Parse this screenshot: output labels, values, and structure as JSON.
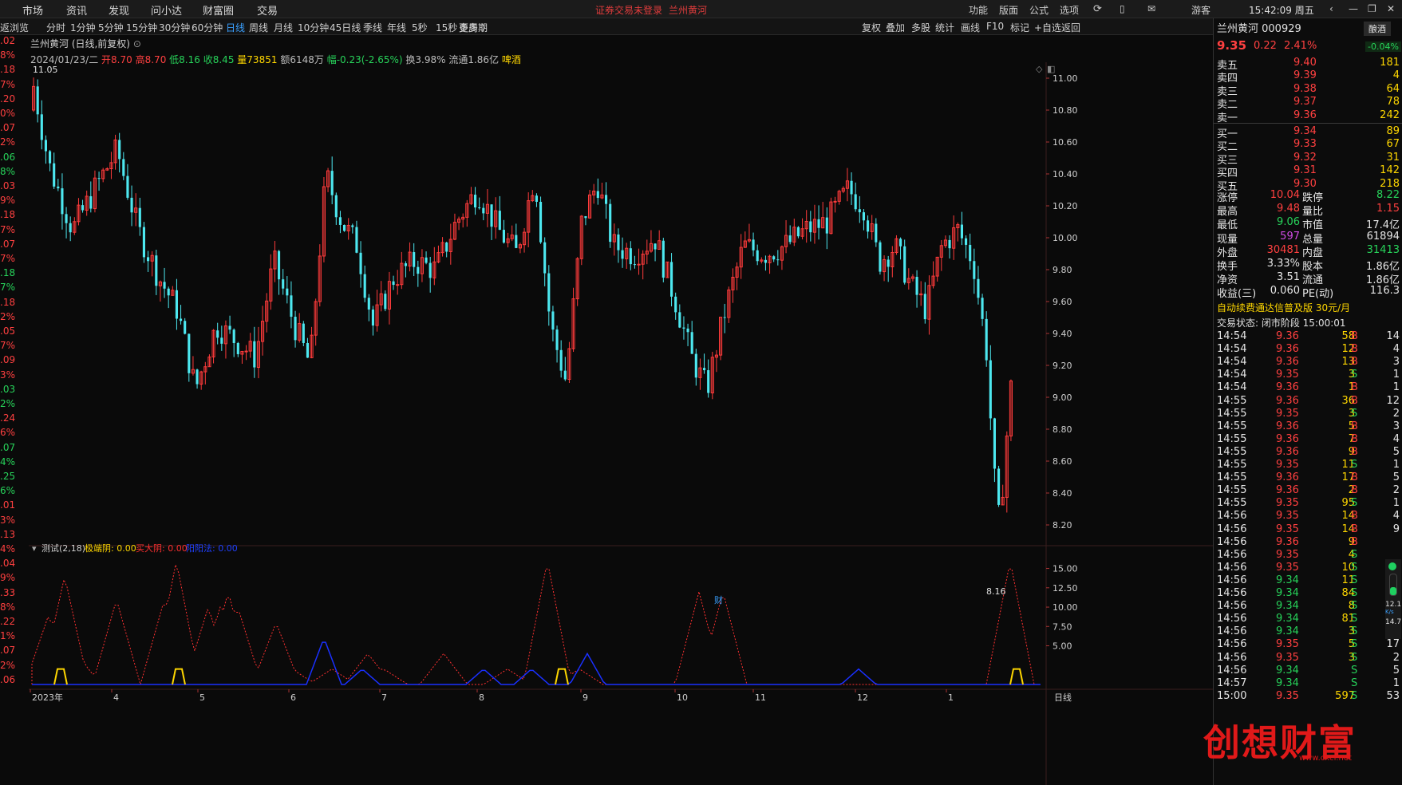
{
  "topbar": {
    "menus": [
      "市场",
      "资讯",
      "发现",
      "问小达",
      "财富圈",
      "交易"
    ],
    "notice_login": "证券交易未登录",
    "notice_stock": "兰州黄河",
    "tools": [
      "功能",
      "版面",
      "公式",
      "选项"
    ],
    "user": "游客",
    "clock": "15:42:09 周五"
  },
  "periodbar": {
    "left_label": "返浏览",
    "periods": [
      "分时",
      "1分钟",
      "5分钟",
      "15分钟",
      "30分钟",
      "60分钟",
      "日线",
      "周线",
      "月线",
      "10分钟",
      "45日线",
      "季线",
      "年线",
      "5秒",
      "15秒",
      "多周期",
      "更多 〉"
    ],
    "active": "日线",
    "right_tools": [
      "复权",
      "叠加",
      "多股",
      "统计",
      "画线",
      "F10",
      "标记",
      "+自选",
      "返回"
    ]
  },
  "chart": {
    "title": "兰州黄河 (日线,前复权)",
    "date": "2024/01/23/二",
    "open_label": "开8.70",
    "high_label": "高8.70",
    "low_label": "低8.16",
    "close_label": "收8.45",
    "volume_label": "量73851",
    "amount_label": "额6148万",
    "change_label": "幅-0.23(-2.65%)",
    "turnover_label": "换3.98%",
    "float_label": "流通1.86亿",
    "sector_label": "啤酒",
    "max_marker": "11.05",
    "min_marker": "8.16",
    "price_ticks": [
      "11.00",
      "10.80",
      "10.60",
      "10.40",
      "10.20",
      "10.00",
      "9.80",
      "9.60",
      "9.40",
      "9.20",
      "9.00",
      "8.80",
      "8.60",
      "8.40",
      "8.20"
    ],
    "finance_marker": "财",
    "indicator_label": "测试(2,18)",
    "ind_series1": "极端阴: 0.00",
    "ind_series2": "买大阴: 0.00",
    "ind_series3": "阳阳法: 0.00",
    "ind_ticks": [
      "15.00",
      "12.50",
      "10.00",
      "7.50",
      "5.00"
    ],
    "x_labels": [
      "2023年",
      "4",
      "5",
      "6",
      "7",
      "8",
      "9",
      "10",
      "11",
      "12",
      "1"
    ],
    "x_right_label": "日线"
  },
  "left_strip": [
    {
      "t": ".02",
      "c": "#ff4040"
    },
    {
      "t": "8%",
      "c": "#ff4040"
    },
    {
      "t": ".18",
      "c": "#ff4040"
    },
    {
      "t": "7%",
      "c": "#ff4040"
    },
    {
      "t": ".20",
      "c": "#ff4040"
    },
    {
      "t": "0%",
      "c": "#ff4040"
    },
    {
      "t": ".07",
      "c": "#ff4040"
    },
    {
      "t": "2%",
      "c": "#ff4040"
    },
    {
      "t": ".06",
      "c": "#27d35a"
    },
    {
      "t": "8%",
      "c": "#27d35a"
    },
    {
      "t": ".03",
      "c": "#ff4040"
    },
    {
      "t": "9%",
      "c": "#ff4040"
    },
    {
      "t": ".18",
      "c": "#ff4040"
    },
    {
      "t": "7%",
      "c": "#ff4040"
    },
    {
      "t": ".07",
      "c": "#ff4040"
    },
    {
      "t": "7%",
      "c": "#ff4040"
    },
    {
      "t": ".18",
      "c": "#27d35a"
    },
    {
      "t": "7%",
      "c": "#27d35a"
    },
    {
      "t": ".18",
      "c": "#ff4040"
    },
    {
      "t": "2%",
      "c": "#ff4040"
    },
    {
      "t": ".05",
      "c": "#ff4040"
    },
    {
      "t": "7%",
      "c": "#ff4040"
    },
    {
      "t": ".09",
      "c": "#ff4040"
    },
    {
      "t": "3%",
      "c": "#ff4040"
    },
    {
      "t": ".03",
      "c": "#27d35a"
    },
    {
      "t": "2%",
      "c": "#27d35a"
    },
    {
      "t": ".24",
      "c": "#ff4040"
    },
    {
      "t": "6%",
      "c": "#ff4040"
    },
    {
      "t": ".07",
      "c": "#27d35a"
    },
    {
      "t": "4%",
      "c": "#27d35a"
    },
    {
      "t": ".25",
      "c": "#27d35a"
    },
    {
      "t": "6%",
      "c": "#27d35a"
    },
    {
      "t": ".01",
      "c": "#ff4040"
    },
    {
      "t": "3%",
      "c": "#ff4040"
    },
    {
      "t": ".13",
      "c": "#ff4040"
    },
    {
      "t": "4%",
      "c": "#ff4040"
    },
    {
      "t": ".04",
      "c": "#ff4040"
    },
    {
      "t": "9%",
      "c": "#ff4040"
    },
    {
      "t": ".33",
      "c": "#ff4040"
    },
    {
      "t": "8%",
      "c": "#ff4040"
    },
    {
      "t": ".22",
      "c": "#ff4040"
    },
    {
      "t": "1%",
      "c": "#ff4040"
    },
    {
      "t": ".07",
      "c": "#ff4040"
    },
    {
      "t": "2%",
      "c": "#ff4040"
    },
    {
      "t": ".06",
      "c": "#ff4040"
    }
  ],
  "quote": {
    "name": "兰州黄河 000929",
    "sector": "酿酒",
    "price": "9.35",
    "change": "0.22",
    "pct": "2.41%",
    "sector_pct": "-0.04%",
    "asks": [
      {
        "label": "卖五",
        "price": "9.40",
        "vol": "181"
      },
      {
        "label": "卖四",
        "price": "9.39",
        "vol": "4"
      },
      {
        "label": "卖三",
        "price": "9.38",
        "vol": "64"
      },
      {
        "label": "卖二",
        "price": "9.37",
        "vol": "78"
      },
      {
        "label": "卖一",
        "price": "9.36",
        "vol": "242"
      }
    ],
    "bids": [
      {
        "label": "买一",
        "price": "9.34",
        "vol": "89"
      },
      {
        "label": "买二",
        "price": "9.33",
        "vol": "67"
      },
      {
        "label": "买三",
        "price": "9.32",
        "vol": "31"
      },
      {
        "label": "买四",
        "price": "9.31",
        "vol": "142"
      },
      {
        "label": "买五",
        "price": "9.30",
        "vol": "218"
      }
    ],
    "stats": [
      {
        "l1": "涨停",
        "v1": "10.04",
        "c1": "red",
        "l2": "跌停",
        "v2": "8.22",
        "c2": "green"
      },
      {
        "l1": "最高",
        "v1": "9.48",
        "c1": "red",
        "l2": "量比",
        "v2": "1.15",
        "c2": "red"
      },
      {
        "l1": "最低",
        "v1": "9.06",
        "c1": "green",
        "l2": "市值",
        "v2": "17.4亿",
        "c2": "white"
      },
      {
        "l1": "现量",
        "v1": "597",
        "c1": "purple",
        "l2": "总量",
        "v2": "61894",
        "c2": "white"
      },
      {
        "l1": "外盘",
        "v1": "30481",
        "c1": "red",
        "l2": "内盘",
        "v2": "31413",
        "c2": "green"
      },
      {
        "l1": "换手",
        "v1": "3.33%",
        "c1": "white",
        "l2": "股本",
        "v2": "1.86亿",
        "c2": "white"
      },
      {
        "l1": "净资",
        "v1": "3.51",
        "c1": "white",
        "l2": "流通",
        "v2": "1.86亿",
        "c2": "white"
      },
      {
        "l1": "收益(三)",
        "v1": "0.060",
        "c1": "white",
        "l2": "PE(动)",
        "v2": "116.3",
        "c2": "white"
      }
    ],
    "promo": "自动续费通达信普及版  30元/月",
    "trade_status": "交易状态: 闭市阶段 15:00:01",
    "ticks": [
      {
        "t": "14:54",
        "p": "9.36",
        "v": "58",
        "s": "B",
        "n": "14"
      },
      {
        "t": "14:54",
        "p": "9.36",
        "v": "12",
        "s": "B",
        "n": "4"
      },
      {
        "t": "14:54",
        "p": "9.36",
        "v": "13",
        "s": "B",
        "n": "3"
      },
      {
        "t": "14:54",
        "p": "9.35",
        "v": "3",
        "s": "S",
        "n": "1"
      },
      {
        "t": "14:54",
        "p": "9.36",
        "v": "1",
        "s": "B",
        "n": "1"
      },
      {
        "t": "14:55",
        "p": "9.36",
        "v": "36",
        "s": "B",
        "n": "12"
      },
      {
        "t": "14:55",
        "p": "9.35",
        "v": "3",
        "s": "S",
        "n": "2"
      },
      {
        "t": "14:55",
        "p": "9.36",
        "v": "5",
        "s": "B",
        "n": "3"
      },
      {
        "t": "14:55",
        "p": "9.36",
        "v": "7",
        "s": "B",
        "n": "4"
      },
      {
        "t": "14:55",
        "p": "9.36",
        "v": "9",
        "s": "B",
        "n": "5"
      },
      {
        "t": "14:55",
        "p": "9.35",
        "v": "11",
        "s": "S",
        "n": "1"
      },
      {
        "t": "14:55",
        "p": "9.36",
        "v": "17",
        "s": "B",
        "n": "5"
      },
      {
        "t": "14:55",
        "p": "9.36",
        "v": "2",
        "s": "B",
        "n": "2"
      },
      {
        "t": "14:55",
        "p": "9.35",
        "v": "95",
        "s": "S",
        "n": "1"
      },
      {
        "t": "14:56",
        "p": "9.35",
        "v": "14",
        "s": "B",
        "n": "4"
      },
      {
        "t": "14:56",
        "p": "9.35",
        "v": "14",
        "s": "B",
        "n": "9"
      },
      {
        "t": "14:56",
        "p": "9.36",
        "v": "9",
        "s": "B",
        "n": ""
      },
      {
        "t": "14:56",
        "p": "9.35",
        "v": "4",
        "s": "S",
        "n": ""
      },
      {
        "t": "14:56",
        "p": "9.35",
        "v": "10",
        "s": "S",
        "n": ""
      },
      {
        "t": "14:56",
        "p": "9.34",
        "v": "11",
        "s": "S",
        "n": ""
      },
      {
        "t": "14:56",
        "p": "9.34",
        "v": "84",
        "s": "S",
        "n": ""
      },
      {
        "t": "14:56",
        "p": "9.34",
        "v": "8",
        "s": "S",
        "n": ""
      },
      {
        "t": "14:56",
        "p": "9.34",
        "v": "81",
        "s": "S",
        "n": ""
      },
      {
        "t": "14:56",
        "p": "9.34",
        "v": "3",
        "s": "S",
        "n": "1"
      },
      {
        "t": "14:56",
        "p": "9.35",
        "v": "5",
        "s": "S",
        "n": "17"
      },
      {
        "t": "14:56",
        "p": "9.35",
        "v": "3",
        "s": "S",
        "n": "2"
      },
      {
        "t": "14:56",
        "p": "9.34",
        "v": "",
        "s": "S",
        "n": "5"
      },
      {
        "t": "14:57",
        "p": "9.34",
        "v": "",
        "s": "S",
        "n": "1"
      },
      {
        "t": "15:00",
        "p": "9.35",
        "v": "597",
        "s": "S",
        "n": "53"
      }
    ],
    "net_up": "12.1",
    "net_down": "14.7",
    "net_unit": "K/s"
  },
  "watermark": "创想财富",
  "watermark_sub": "www.cxcf.net"
}
